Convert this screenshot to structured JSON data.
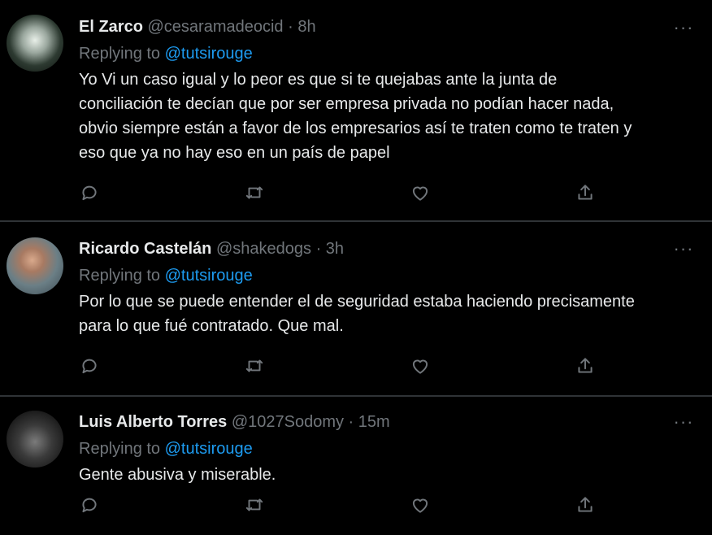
{
  "tweets": [
    {
      "name": "El Zarco",
      "handle": "@cesaramadeocid",
      "sep": "·",
      "time": "8h",
      "replying_prefix": "Replying to",
      "replying_to": "@tutsirouge",
      "text_lines": [
        "Yo Vi un caso igual y lo peor es que si te quejabas ante la junta de",
        "conciliación te decían que por ser empresa privada no podían hacer nada,",
        "obvio siempre están a favor de los empresarios así te traten como te traten y",
        "eso que ya no hay eso en un país de papel"
      ]
    },
    {
      "name": "Ricardo Castelán",
      "handle": "@shakedogs",
      "sep": "·",
      "time": "3h",
      "replying_prefix": "Replying to",
      "replying_to": "@tutsirouge",
      "text_lines": [
        "Por lo que se puede entender el de seguridad estaba haciendo precisamente",
        "para lo que fué contratado. Que mal."
      ]
    },
    {
      "name": "Luis Alberto Torres",
      "handle": "@1027Sodomy",
      "sep": "·",
      "time": "15m",
      "replying_prefix": "Replying to",
      "replying_to": "@tutsirouge",
      "text_lines": [
        "Gente abusiva y miserable."
      ]
    }
  ],
  "icons": {
    "more": "more-horizontal-icon",
    "reply": "reply-icon",
    "retweet": "retweet-icon",
    "like": "like-icon",
    "share": "share-icon"
  },
  "colors": {
    "background": "#000000",
    "text": "#e7e9ea",
    "secondary": "#71767b",
    "accent": "#1d9bf0",
    "divider": "#2f3336"
  }
}
